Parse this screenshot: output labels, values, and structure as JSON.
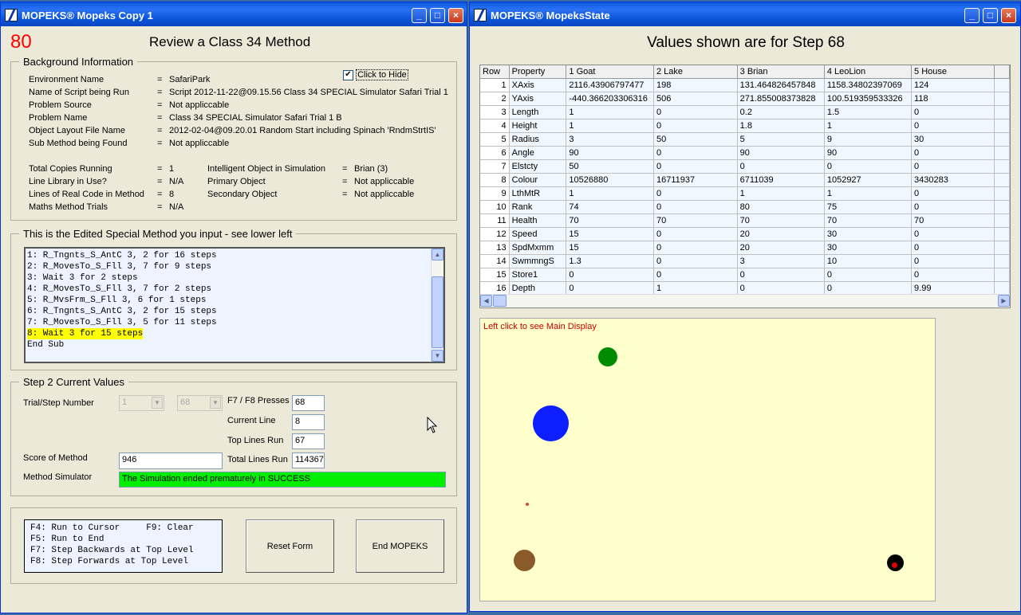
{
  "left_window": {
    "title": "MOPEKS® Mopeks Copy 1",
    "score_big": "80",
    "heading": "Review a Class 34 Method",
    "background": {
      "group_title": "Background Information",
      "hide_checkbox_label": "Click to Hide",
      "rows": [
        {
          "label": "Environment Name",
          "value": "SafariPark"
        },
        {
          "label": "Name of Script being Run",
          "value": "Script 2012-11-22@09.15.56 Class 34 SPECIAL Simulator Safari Trial 1"
        },
        {
          "label": "Problem Source",
          "value": "Not appliccable"
        },
        {
          "label": "Problem Name",
          "value": "Class 34 SPECIAL Simulator Safari Trial 1 B"
        },
        {
          "label": "Object Layout File Name",
          "value": "2012-02-04@09.20.01 Random Start including Spinach 'RndmStrtIS'"
        },
        {
          "label": "Sub Method being Found",
          "value": "Not appliccable"
        }
      ],
      "rows2_left": [
        {
          "label": "Total Copies Running",
          "value": "1"
        },
        {
          "label": "Line Library in Use?",
          "value": "N/A"
        },
        {
          "label": "Lines of Real Code in Method",
          "value": "8"
        },
        {
          "label": "Maths Method Trials",
          "value": "N/A"
        }
      ],
      "rows2_right": [
        {
          "label": "Intelligent Object in Simulation",
          "value": "Brian (3)"
        },
        {
          "label": "Primary Object",
          "value": "Not appliccable"
        },
        {
          "label": "Secondary Object",
          "value": "Not appliccable"
        }
      ],
      "eq": "="
    },
    "method": {
      "group_title": "This is the Edited Special Method you input - see lower left",
      "lines": [
        "1: R_Tngnts_S_AntC 3, 2 for 16 steps",
        "2: R_MovesTo_S_Fll 3, 7 for 9 steps",
        "3: Wait 3 for 2 steps",
        "4: R_MovesTo_S_Fll 3, 7 for 2 steps",
        "5: R_MvsFrm_S_Fll 3, 6 for 1 steps",
        "6: R_Tngnts_S_AntC 3, 2 for 15 steps",
        "7: R_MovesTo_S_Fll 3, 5 for 11 steps",
        "8: Wait 3 for 15 steps",
        "End Sub"
      ],
      "highlight_index": 7,
      "highlight_color": "#ffff00"
    },
    "step2": {
      "group_title": "Step 2   Current Values",
      "trial_step_label": "Trial/Step Number",
      "trial_value": "1",
      "step_value": "68",
      "f7f8_label": "F7 / F8 Presses",
      "f7f8_value": "68",
      "current_line_label": "Current Line",
      "current_line_value": "8",
      "top_lines_label": "Top Lines Run",
      "top_lines_value": "67",
      "score_label": "Score of Method",
      "score_value": "946",
      "total_lines_label": "Total Lines Run",
      "total_lines_value": "114367",
      "simulator_label": "Method Simulator",
      "simulator_value": "The Simulation ended prematurely in SUCCESS",
      "simulator_color": "#00ee00"
    },
    "keys": {
      "lines": [
        "F4: Run to Cursor     F9: Clear",
        "F5: Run to End",
        "F7: Step Backwards at Top Level",
        "F8: Step Forwards at Top Level"
      ],
      "reset_label": "Reset Form",
      "end_label": "End MOPEKS"
    }
  },
  "right_window": {
    "title": "MOPEKS® MopeksState",
    "heading": "Values shown are for Step 68",
    "grid": {
      "headers": [
        "Row",
        "Property",
        "1 Goat",
        "2 Lake",
        "3 Brian",
        "4 LeoLion",
        "5 House"
      ],
      "rows": [
        [
          "1",
          "XAxis",
          "2116.43906797477",
          "198",
          "131.464826457848",
          "1158.34802397069",
          "124"
        ],
        [
          "2",
          "YAxis",
          "-440.366203306316",
          "506",
          "271.855008373828",
          "100.519359533326",
          "118"
        ],
        [
          "3",
          "Length",
          "1",
          "0",
          "0.2",
          "1.5",
          "0"
        ],
        [
          "4",
          "Height",
          "1",
          "0",
          "1.8",
          "1",
          "0"
        ],
        [
          "5",
          "Radius",
          "3",
          "50",
          "5",
          "9",
          "30"
        ],
        [
          "6",
          "Angle",
          "90",
          "0",
          "90",
          "90",
          "0"
        ],
        [
          "7",
          "Elstcty",
          "50",
          "0",
          "0",
          "0",
          "0"
        ],
        [
          "8",
          "Colour",
          "10526880",
          "16711937",
          "6711039",
          "1052927",
          "3430283"
        ],
        [
          "9",
          "LthMtR",
          "1",
          "0",
          "1",
          "1",
          "0"
        ],
        [
          "10",
          "Rank",
          "74",
          "0",
          "80",
          "75",
          "0"
        ],
        [
          "11",
          "Health",
          "70",
          "70",
          "70",
          "70",
          "70"
        ],
        [
          "12",
          "Speed",
          "15",
          "0",
          "20",
          "30",
          "0"
        ],
        [
          "13",
          "SpdMxmm",
          "15",
          "0",
          "20",
          "30",
          "0"
        ],
        [
          "14",
          "SwmmngS",
          "1.3",
          "0",
          "3",
          "10",
          "0"
        ],
        [
          "15",
          "Store1",
          "0",
          "0",
          "0",
          "0",
          "0"
        ],
        [
          "16",
          "Depth",
          "0",
          "1",
          "0",
          "0",
          "9.99"
        ]
      ]
    },
    "display": {
      "hint": "Left click to see Main Display",
      "hint_color": "#cc0000",
      "background": "#ffffcc"
    }
  }
}
